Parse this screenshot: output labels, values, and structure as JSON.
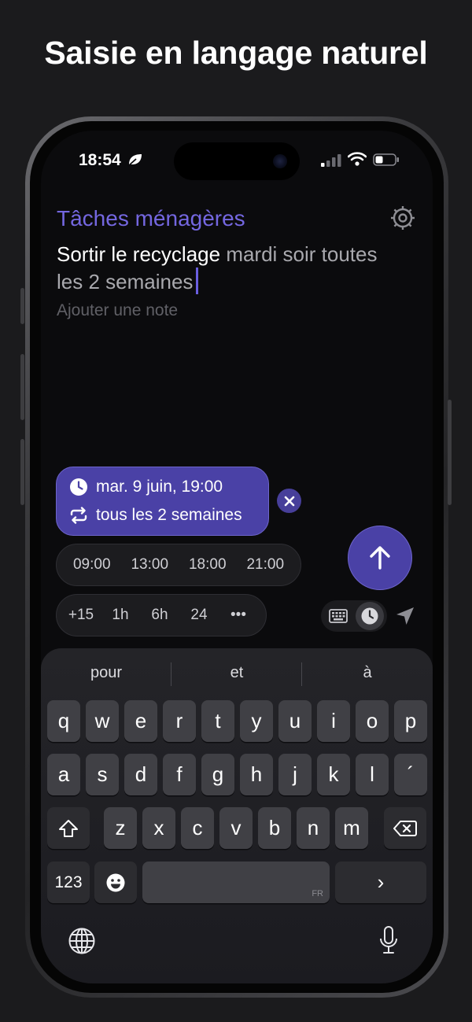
{
  "headline": "Saisie en langage naturel",
  "status_bar": {
    "time": "18:54"
  },
  "editor": {
    "list_title": "Tâches ménagères",
    "task_title": "Sortir le recyclage",
    "parsed_text_line1": "mardi soir toutes",
    "parsed_text_line2": "les 2 semaines",
    "note_placeholder": "Ajouter une note"
  },
  "schedule_chip": {
    "date": "mar. 9 juin, 19:00",
    "repeat": "tous les 2 semaines"
  },
  "time_options": [
    "09:00",
    "13:00",
    "18:00",
    "21:00"
  ],
  "duration_options": [
    "+15",
    "1h",
    "6h",
    "24",
    "•••"
  ],
  "keyboard": {
    "suggestions": [
      "pour",
      "et",
      "à"
    ],
    "row1": [
      "q",
      "w",
      "e",
      "r",
      "t",
      "y",
      "u",
      "i",
      "o",
      "p"
    ],
    "row2": [
      "a",
      "s",
      "d",
      "f",
      "g",
      "h",
      "j",
      "k",
      "l",
      "´"
    ],
    "row3": [
      "z",
      "x",
      "c",
      "v",
      "b",
      "n",
      "m"
    ],
    "numbers_label": "123",
    "return_label": "›",
    "space_language": "FR"
  },
  "colors": {
    "accent": "#4a41a6",
    "accent_border": "#6e65cc",
    "title_purple": "#7467e0",
    "background": "#0b0b0d"
  }
}
